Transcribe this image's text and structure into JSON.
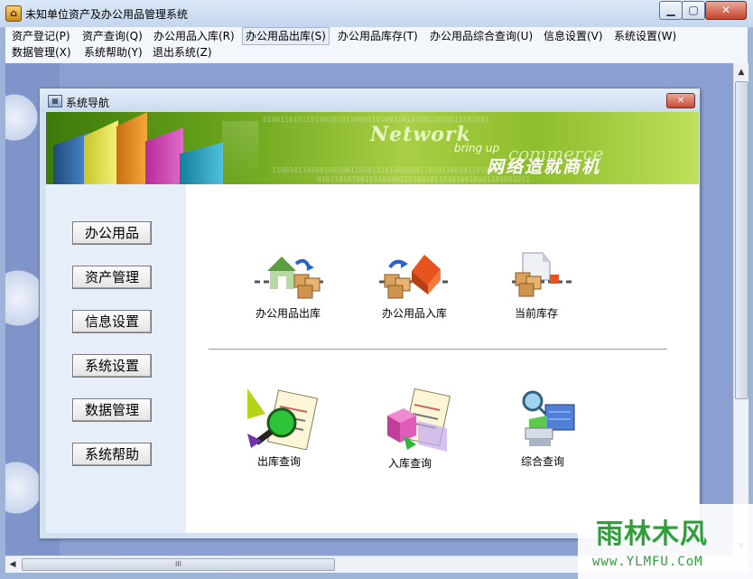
{
  "window": {
    "title": "未知单位资产及办公用品管理系统",
    "app_icon": "house-icon",
    "min_glyph": "▁",
    "max_glyph": "▢",
    "close_glyph": "✕"
  },
  "menu": {
    "row1": [
      "资产登记(P)",
      "资产查询(Q)",
      "办公用品入库(R)",
      "办公用品出库(S)",
      "办公用品库存(T)",
      "办公用品综合查询(U)",
      "信息设置(V)",
      "系统设置(W)"
    ],
    "row2": [
      "数据管理(X)",
      "系统帮助(Y)",
      "退出系统(Z)"
    ],
    "active": "办公用品出库(S)"
  },
  "dialog": {
    "title": "系统导航",
    "close_glyph": "✕",
    "banner": {
      "network": "Network",
      "bring_up": "bring up",
      "commerce": "commerce",
      "slogan": "网络造就商机"
    },
    "nav": [
      "办公用品",
      "资产管理",
      "信息设置",
      "系统设置",
      "数据管理",
      "系统帮助"
    ],
    "tiles_top": [
      {
        "label": "办公用品出库",
        "icon": "outbound-house-icon"
      },
      {
        "label": "办公用品入库",
        "icon": "inbound-house-icon"
      },
      {
        "label": "当前库存",
        "icon": "inventory-boxes-icon"
      }
    ],
    "tiles_bottom": [
      {
        "label": "出库查询",
        "icon": "magnifier-document-icon"
      },
      {
        "label": "入库查询",
        "icon": "cube-document-icon"
      },
      {
        "label": "综合查询",
        "icon": "search-computer-icon"
      }
    ]
  },
  "scrollbar": {
    "grip": "III"
  },
  "watermark": {
    "logo": "雨林木风",
    "url": "www.YLMFU.CoM"
  }
}
